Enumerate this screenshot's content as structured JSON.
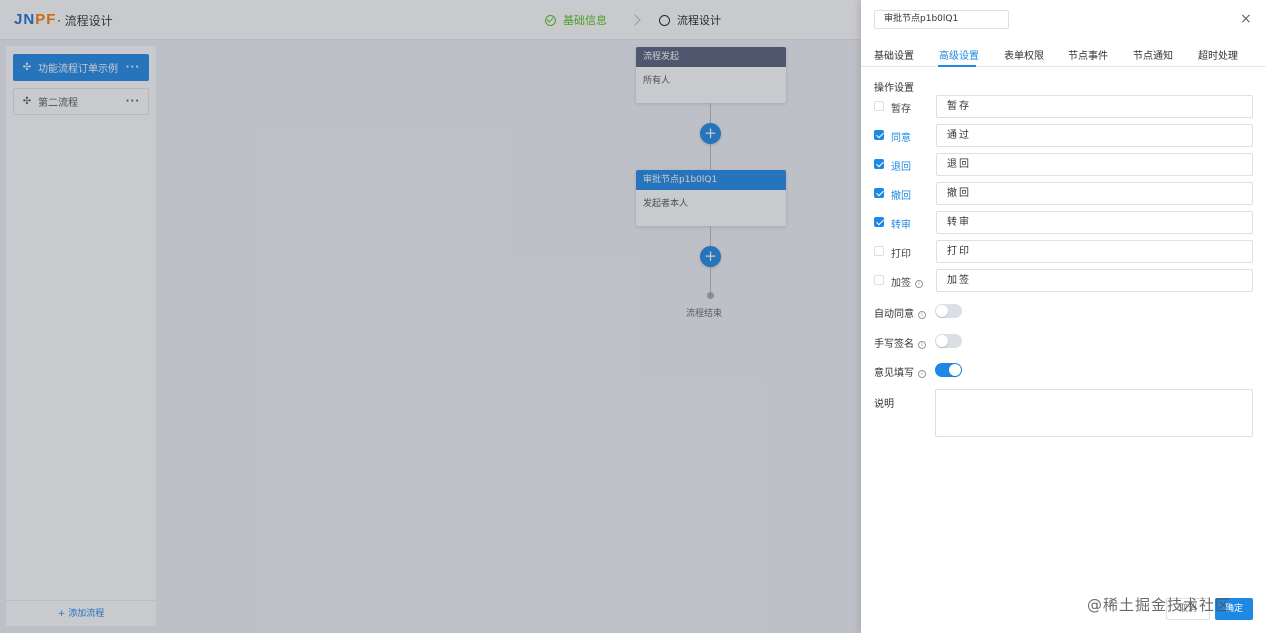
{
  "topbar": {
    "logo_main": "JN",
    "logo_accent": "PF",
    "title": "· 流程设计",
    "steps": [
      {
        "label": "基础信息",
        "state": "done"
      },
      {
        "label": "流程设计",
        "state": "current"
      }
    ]
  },
  "sidebar": {
    "flows": [
      {
        "label": "功能流程订单示例",
        "active": true
      },
      {
        "label": "第二流程",
        "active": false
      }
    ],
    "more_glyph": "···",
    "add_label": "+ 添加流程"
  },
  "canvas": {
    "start_node": {
      "title": "流程发起",
      "body": "所有人"
    },
    "approve_node": {
      "title": "审批节点p1b0lQ1",
      "body": "发起者本人"
    },
    "add_glyph": "+",
    "end_label": "流程结束"
  },
  "drawer": {
    "node_name": "审批节点p1b0lQ1",
    "close_glyph": "×",
    "tabs": [
      "基础设置",
      "高级设置",
      "表单权限",
      "节点事件",
      "节点通知",
      "超时处理"
    ],
    "active_tab": "高级设置",
    "section_title": "操作设置",
    "operations": [
      {
        "label": "暂存",
        "checked": false,
        "value": "暂存",
        "info": false
      },
      {
        "label": "同意",
        "checked": true,
        "value": "通过",
        "info": false
      },
      {
        "label": "退回",
        "checked": true,
        "value": "退回",
        "info": false
      },
      {
        "label": "撤回",
        "checked": true,
        "value": "撤回",
        "info": false
      },
      {
        "label": "转审",
        "checked": true,
        "value": "转审",
        "info": false
      },
      {
        "label": "打印",
        "checked": false,
        "value": "打印",
        "info": false
      },
      {
        "label": "加签",
        "checked": false,
        "value": "加签",
        "info": true
      }
    ],
    "switches": [
      {
        "label": "自动同意",
        "on": false
      },
      {
        "label": "手写签名",
        "on": false
      },
      {
        "label": "意见填写",
        "on": true
      }
    ],
    "description_label": "说明",
    "description_value": "",
    "cancel_label": "取消",
    "ok_label": "确定"
  },
  "watermark": "@稀土掘金技术社区",
  "colors": {
    "primary": "#1e88e5",
    "success": "#52c41a",
    "logo_blue": "#1e6fd9",
    "logo_orange": "#ff7a00"
  }
}
